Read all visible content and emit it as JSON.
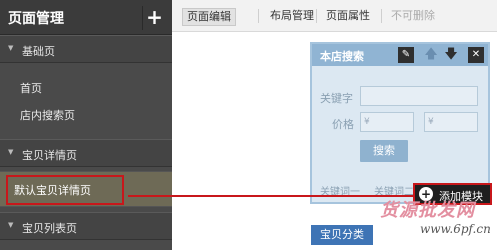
{
  "sidebar": {
    "title": "页面管理",
    "add_label": "+",
    "sections": [
      {
        "label": "基础页",
        "items": [
          "首页",
          "店内搜索页"
        ]
      },
      {
        "label": "宝贝详情页",
        "items": [
          "默认宝贝详情页"
        ]
      },
      {
        "label": "宝贝列表页",
        "items": []
      }
    ],
    "active_item": "默认宝贝详情页"
  },
  "toolbar": {
    "tabs": [
      "页面编辑",
      "布局管理",
      "页面属性"
    ],
    "disabled_label": "不可删除"
  },
  "search_panel": {
    "title": "本店搜索",
    "keyword_label": "关键字",
    "price_label": "价格",
    "currency_symbol": "¥",
    "search_button": "搜索",
    "keyword_1": "关键词一",
    "keyword_2": "关键词二",
    "icons": [
      "edit-icon",
      "arrow-up-icon",
      "arrow-down-icon",
      "close-icon"
    ]
  },
  "add_module": {
    "label": "添加模块"
  },
  "category_button": {
    "label": "宝贝分类"
  },
  "watermark": {
    "line1": "货源批发网",
    "line2": "www.6pf.cn"
  },
  "colors": {
    "highlight": "#c8171b",
    "panel_head": "#90b4d3",
    "category_blue": "#3e74b5"
  }
}
